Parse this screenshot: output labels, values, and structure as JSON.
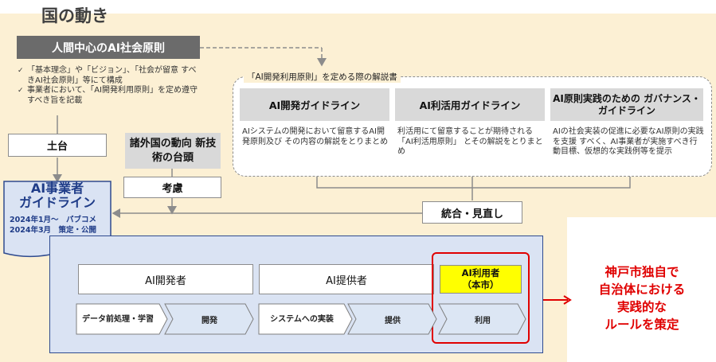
{
  "title": "国の動き",
  "principles": {
    "header": "人間中心のAI社会原則",
    "bullets": [
      "「基本理念」や「ビジョン」、「社会が留意 すべきAI社会原則」等にて構成",
      "事業者において、「AI開発利用原則」を定め遵守すべき旨を記載"
    ]
  },
  "foundation_label": "土台",
  "foreign_label": "諸外国の動向 新技術の台頭",
  "consider_label": "考慮",
  "guidelines_group": {
    "caption": "「AI開発利用原則」を定める際の解説書",
    "items": [
      {
        "title": "AI開発ガイドライン",
        "desc": "AIシステムの開発において留意するAI開発原則及び その内容の解説をとりまとめ"
      },
      {
        "title": "AI利活用ガイドライン",
        "desc": "利活用にて留意することが期待される「AI利活用原則」 とその解説をとりまとめ"
      },
      {
        "title": "AI原則実践のための ガバナンス・ガイドライン",
        "desc": "AIの社会実装の促進に必要なAI原則の実践を支援 すべく、AI事業者が実施すべき行動目標、仮想的な実践例等を提示"
      }
    ]
  },
  "merge_label": "統合・見直し",
  "business_guideline": {
    "title_line1": "AI事業者",
    "title_line2": "ガイドライン",
    "date1": "2024年1月～　パブコメ",
    "date2": "2024年3月　策定・公開"
  },
  "actors": {
    "developer": "AI開発者",
    "provider": "AI提供者",
    "user_line1": "AI利用者",
    "user_line2": "（本市）"
  },
  "steps": {
    "data": "データ前処理・学習",
    "develop": "開発",
    "impl": "システムへの実装",
    "provide": "提供",
    "use": "利用"
  },
  "kobe_text": [
    "神戸市独自で",
    "自治体における",
    "実践的な",
    "ルールを策定"
  ],
  "colors": {
    "cream": "#fcf0d4",
    "panel_blue": "#dae3f3",
    "panel_border": "#2f4b8f",
    "step_blue": "#dce6f4",
    "highlight_yellow": "#ffff00",
    "red": "#e00000"
  }
}
